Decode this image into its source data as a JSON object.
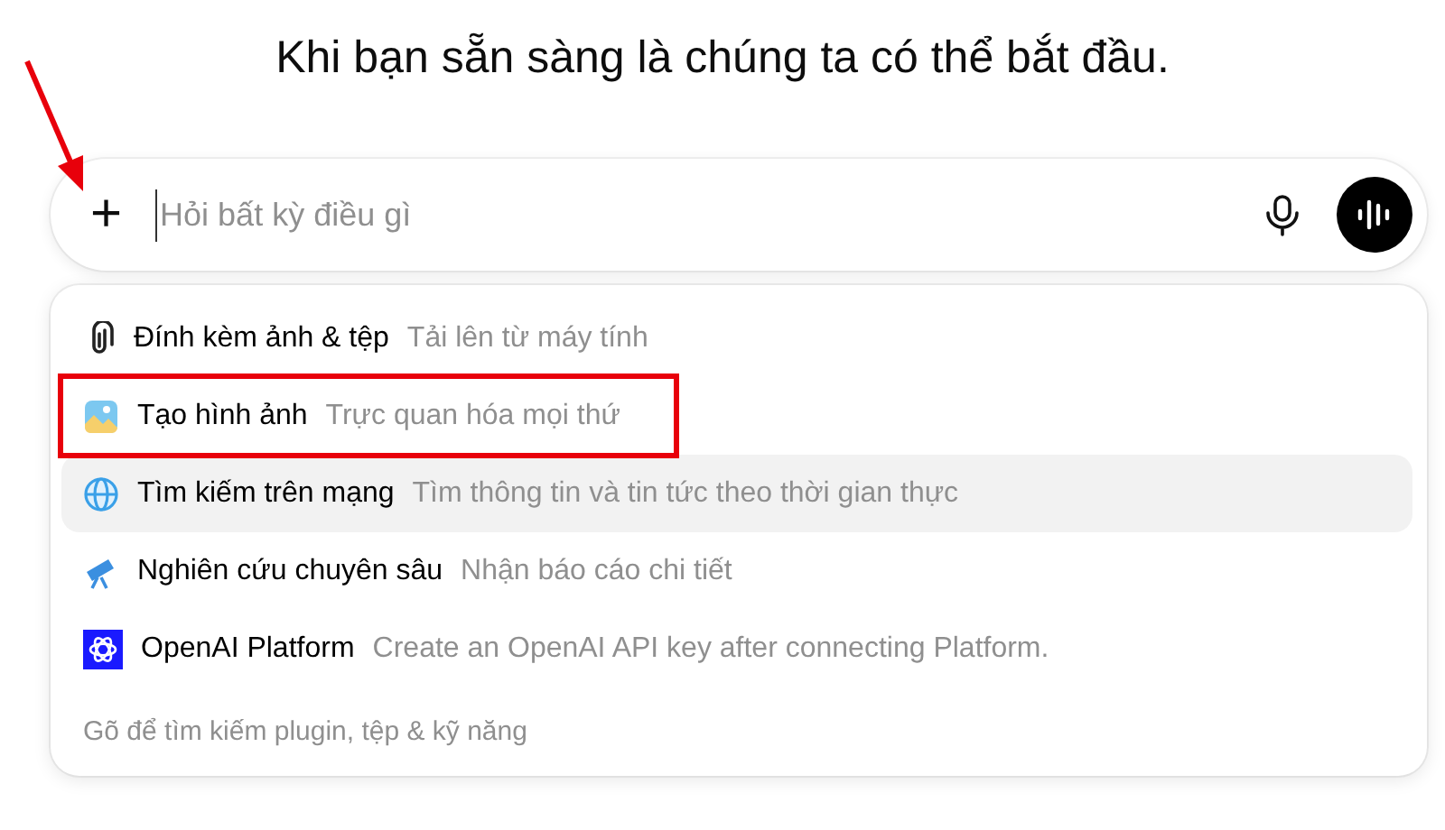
{
  "heading": "Khi bạn sẵn sàng là chúng ta có thể bắt đầu.",
  "prompt": {
    "plus": "+",
    "placeholder": "Hỏi bất kỳ điều gì"
  },
  "menu": {
    "items": [
      {
        "kind": "attach",
        "label": "Đính kèm ảnh & tệp",
        "hint": "Tải lên từ máy tính",
        "selected": false,
        "annotated": false
      },
      {
        "kind": "image",
        "label": "Tạo hình ảnh",
        "hint": "Trực quan hóa mọi thứ",
        "selected": false,
        "annotated": true
      },
      {
        "kind": "globe",
        "label": "Tìm kiếm trên mạng",
        "hint": "Tìm thông tin và tin tức theo thời gian thực",
        "selected": true,
        "annotated": false
      },
      {
        "kind": "telescope",
        "label": "Nghiên cứu chuyên sâu",
        "hint": "Nhận báo cáo chi tiết",
        "selected": false,
        "annotated": false
      },
      {
        "kind": "openai",
        "label": "OpenAI Platform",
        "hint": "Create an OpenAI API key after connecting Platform.",
        "selected": false,
        "annotated": false
      }
    ],
    "footer": "Gõ để tìm kiếm plugin, tệp & kỹ năng"
  }
}
